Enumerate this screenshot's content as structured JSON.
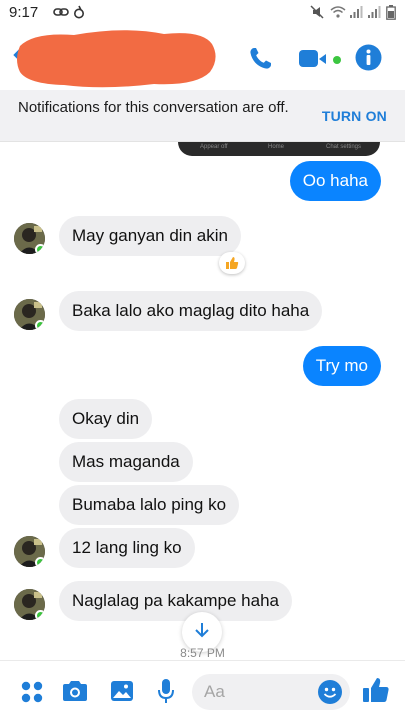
{
  "status_bar": {
    "time": "9:17"
  },
  "header": {
    "contact_name_redacted": true
  },
  "banner": {
    "text": "Notifications for this conversation are off.",
    "action": "TURN ON"
  },
  "dark_strip": {
    "labels": [
      "Appear off",
      "Home",
      "Chat settings"
    ]
  },
  "messages": [
    {
      "text": "Oo haha",
      "sender": "me"
    },
    {
      "text": "May ganyan din akin",
      "sender": "them",
      "reaction": "thumbs-up"
    },
    {
      "text": "Baka lalo ako maglag dito haha",
      "sender": "them"
    },
    {
      "text": "Try mo",
      "sender": "me"
    },
    {
      "text": "Okay din",
      "sender": "them"
    },
    {
      "text": "Mas maganda",
      "sender": "them"
    },
    {
      "text": "Bumaba lalo ping ko",
      "sender": "them"
    },
    {
      "text": "12 lang ling ko",
      "sender": "them"
    },
    {
      "text": "Naglalag pa kakampe haha",
      "sender": "them"
    }
  ],
  "timestamp": "8:57 PM",
  "composer": {
    "placeholder": "Aa"
  },
  "colors": {
    "accent": "#0a84ff",
    "brand_blue": "#1f7ed8",
    "online": "#3cc640",
    "redaction": "#f26b43"
  }
}
